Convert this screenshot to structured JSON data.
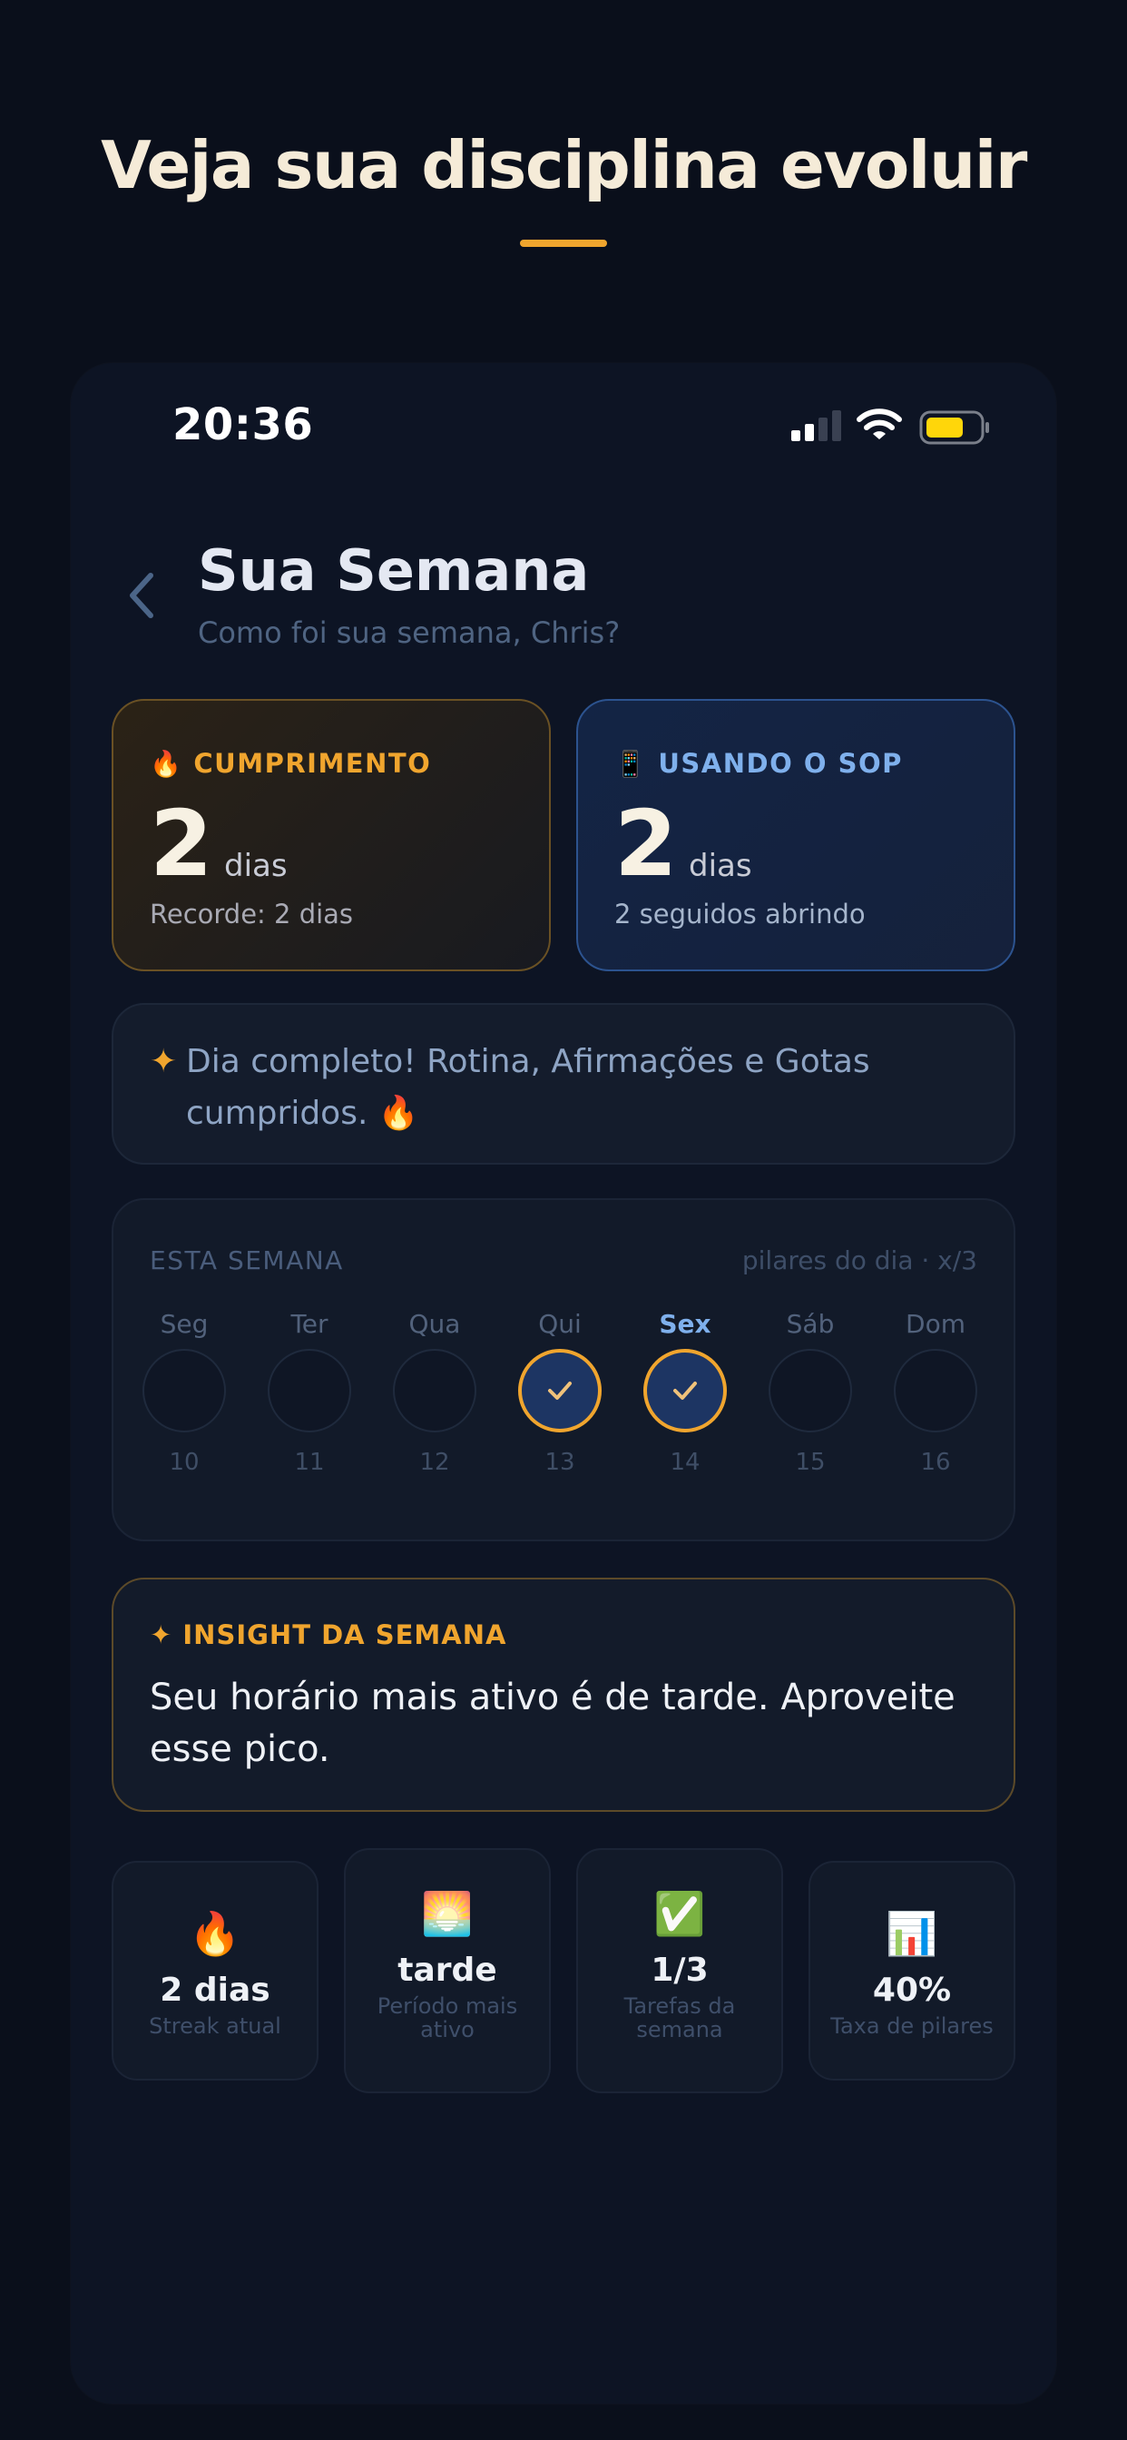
{
  "hero": {
    "title": "Veja sua disciplina evoluir"
  },
  "status_bar": {
    "time": "20:36"
  },
  "header": {
    "title": "Sua Semana",
    "subtitle": "Como foi sua semana, Chris?"
  },
  "cards": {
    "streak": {
      "emoji": "🔥",
      "label": "CUMPRIMENTO",
      "value": "2",
      "unit": "dias",
      "note": "Recorde: 2 dias"
    },
    "sop": {
      "emoji": "📱",
      "label": "USANDO O SOP",
      "value": "2",
      "unit": "dias",
      "note": "2 seguidos abrindo"
    }
  },
  "complete": {
    "spark": "✦",
    "text": "Dia completo! Rotina, Afirmações e Gotas cumpridos. 🔥"
  },
  "week": {
    "title": "ESTA SEMANA",
    "hint": "pilares do dia · x/3",
    "days": [
      {
        "name": "Seg",
        "num": "10",
        "done": false,
        "today": false
      },
      {
        "name": "Ter",
        "num": "11",
        "done": false,
        "today": false
      },
      {
        "name": "Qua",
        "num": "12",
        "done": false,
        "today": false
      },
      {
        "name": "Qui",
        "num": "13",
        "done": true,
        "today": false
      },
      {
        "name": "Sex",
        "num": "14",
        "done": true,
        "today": true
      },
      {
        "name": "Sáb",
        "num": "15",
        "done": false,
        "today": false
      },
      {
        "name": "Dom",
        "num": "16",
        "done": false,
        "today": false
      }
    ]
  },
  "insight": {
    "label": "✦ INSIGHT DA SEMANA",
    "text": "Seu horário mais ativo é de tarde. Aproveite esse pico."
  },
  "stats": [
    {
      "emoji": "🔥",
      "value": "2 dias",
      "label": "Streak atual"
    },
    {
      "emoji": "🌅",
      "value": "tarde",
      "label": "Período mais ativo"
    },
    {
      "emoji": "✅",
      "value": "1/3",
      "label": "Tarefas da semana"
    },
    {
      "emoji": "📊",
      "value": "40%",
      "label": "Taxa de pilares"
    }
  ],
  "colors": {
    "accent": "#f0a52e",
    "blue_accent": "#7fb0ec",
    "background": "#0a0f1b",
    "battery": "#ffd60a"
  }
}
